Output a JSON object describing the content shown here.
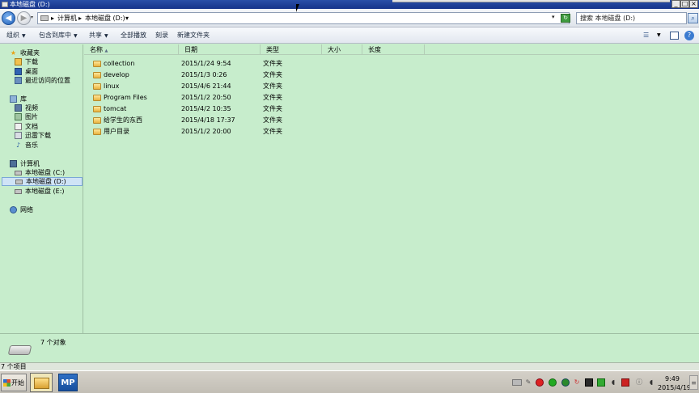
{
  "window": {
    "title": "本地磁盘 (D:)",
    "buttons": {
      "minimize": "_",
      "maximize": "□",
      "close": "×"
    }
  },
  "address": {
    "sep": "▸",
    "crumbs": [
      "计算机",
      "本地磁盘 (D:)"
    ],
    "dropdown": "▾",
    "search_placeholder": "搜索 本地磁盘 (D:)",
    "refresh": "↻"
  },
  "toolbar": {
    "organize": "组织",
    "include_in_library": "包含到库中",
    "share": "共享",
    "play_all": "全部播放",
    "burn": "刻录",
    "new_folder": "新建文件夹",
    "dropdown_arrow": "▼",
    "help": "?"
  },
  "sidebar": {
    "favorites": {
      "label": "收藏夹",
      "items": [
        "下载",
        "桌面",
        "最近访问的位置"
      ]
    },
    "libraries": {
      "label": "库",
      "items": [
        "视频",
        "图片",
        "文档",
        "迅雷下载",
        "音乐"
      ]
    },
    "computer": {
      "label": "计算机",
      "items": [
        "本地磁盘 (C:)",
        "本地磁盘 (D:)",
        "本地磁盘 (E:)"
      ]
    },
    "network": {
      "label": "网络"
    }
  },
  "columns": {
    "name": "名称",
    "sort_arrow": "▲",
    "date": "日期",
    "type": "类型",
    "size": "大小",
    "length": "长度"
  },
  "files": [
    {
      "name": "collection",
      "date": "2015/1/24 9:54",
      "type": "文件夹"
    },
    {
      "name": "develop",
      "date": "2015/1/3 0:26",
      "type": "文件夹"
    },
    {
      "name": "linux",
      "date": "2015/4/6 21:44",
      "type": "文件夹"
    },
    {
      "name": "Program Files",
      "date": "2015/1/2 20:50",
      "type": "文件夹"
    },
    {
      "name": "tomcat",
      "date": "2015/4/2 10:35",
      "type": "文件夹"
    },
    {
      "name": "给学生的东西",
      "date": "2015/4/18 17:37",
      "type": "文件夹"
    },
    {
      "name": "用户目录",
      "date": "2015/1/2 20:00",
      "type": "文件夹"
    }
  ],
  "details": {
    "count": "7 个对象"
  },
  "status": {
    "text": "7 个项目"
  },
  "taskbar": {
    "start": "开始",
    "mp_label": "MP",
    "clock_time": "9:49",
    "clock_date": "2015/4/19"
  },
  "colors": {
    "background": "#c7edcc",
    "titlebar": "#16338a",
    "selection": "#cfe3f6"
  }
}
